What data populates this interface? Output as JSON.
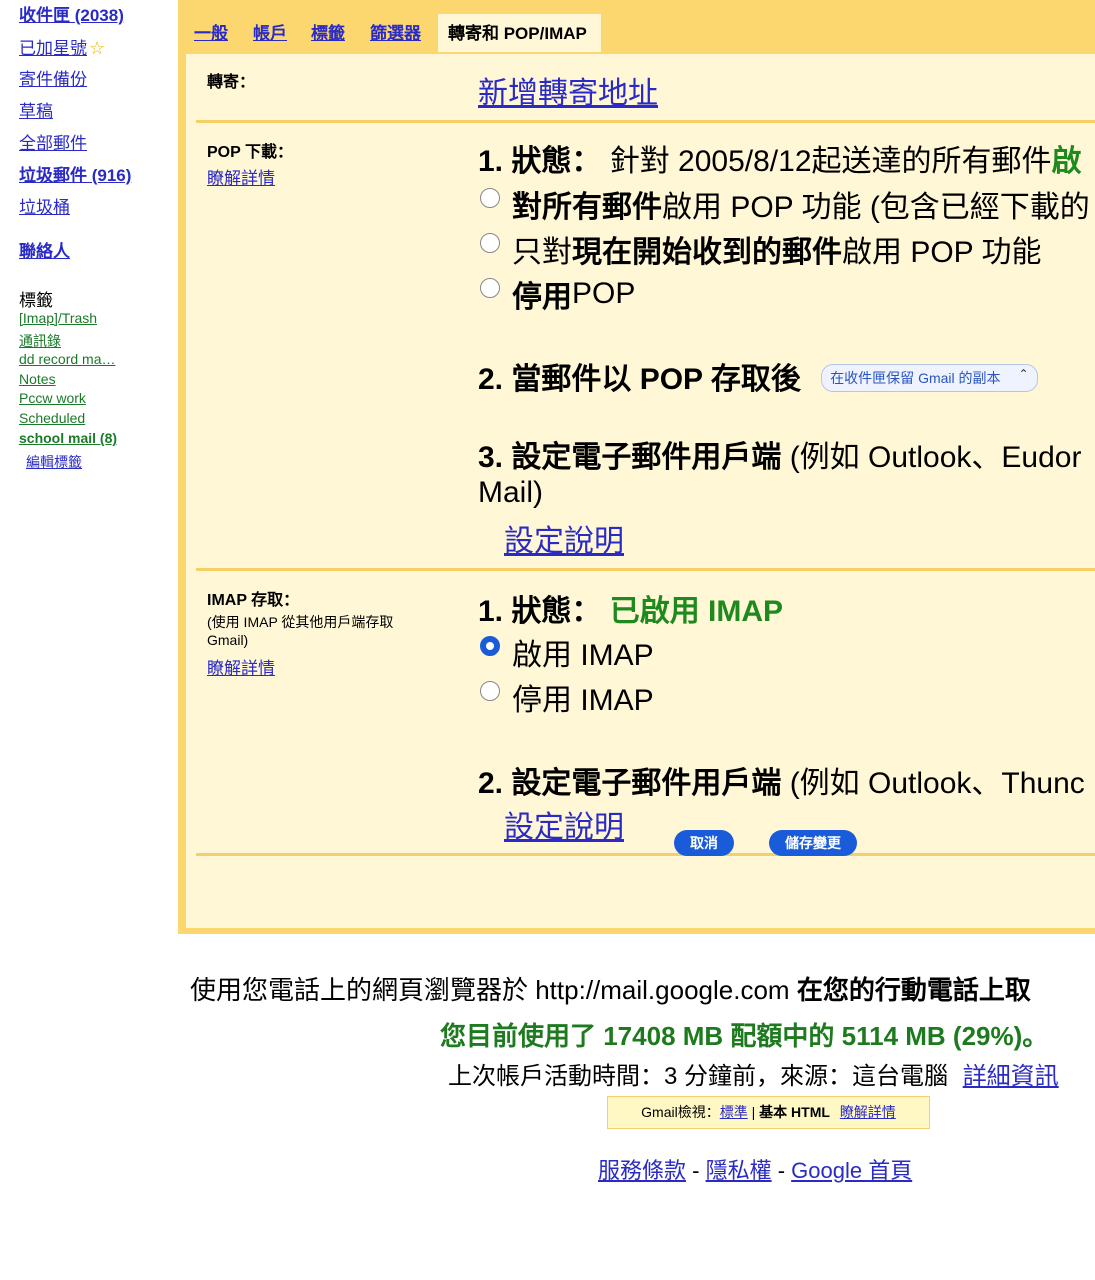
{
  "sidebar": {
    "inbox": "收件匣 (2038)",
    "starred": "已加星號",
    "sent": "寄件備份",
    "drafts": "草稿",
    "all_mail": "全部郵件",
    "spam": "垃圾郵件 (916)",
    "trash": "垃圾桶",
    "contacts": "聯絡人",
    "labels_heading": "標籤",
    "labels": [
      "[Imap]/Trash",
      "通訊錄",
      "dd record ma…",
      "Notes",
      "Pccw work",
      "Scheduled",
      "school mail (8)"
    ],
    "edit_labels": "編輯標籤"
  },
  "tabs": [
    "一般",
    "帳戶",
    "標籤",
    "篩選器",
    "轉寄和 POP/IMAP"
  ],
  "forwarding": {
    "label": "轉寄：",
    "add_link": "新增轉寄地址"
  },
  "pop": {
    "label": "POP 下載：",
    "learn_more": "瞭解詳情",
    "status_label": "1. 狀態：",
    "status_text": "針對 2005/8/12起送達的所有郵件",
    "status_suffix": "啟",
    "opt1_bold": "對所有郵件",
    "opt1_rest": "啟用 POP 功能 (包含已經下載的",
    "opt2_pre": "只對",
    "opt2_bold": "現在開始收到的郵件",
    "opt2_rest": "啟用 POP 功能",
    "opt3_bold": "停用",
    "opt3_rest": " POP",
    "after_label": "2. 當郵件以 POP 存取後",
    "after_select": "在收件匣保留 Gmail 的副本",
    "client_label": "3. 設定電子郵件用戶端",
    "client_text": " (例如 Outlook、Eudor",
    "client_text2": "Mail)",
    "setup_link": "設定說明"
  },
  "imap": {
    "label": "IMAP 存取：",
    "sub1": "(使用 IMAP 從其他用戶端存取",
    "sub2": "Gmail)",
    "learn_more": "瞭解詳情",
    "status_label": "1. 狀態：",
    "status_value": "已啟用 IMAP",
    "opt_enable": "啟用 IMAP",
    "opt_disable": "停用 IMAP",
    "client_label": "2. 設定電子郵件用戶端",
    "client_text": " (例如 Outlook、Thunc",
    "setup_link": "設定說明"
  },
  "buttons": {
    "cancel": "取消",
    "save": "儲存變更"
  },
  "footer": {
    "mobile_text": "使用您電話上的網頁瀏覽器於 http://mail.google.com ",
    "mobile_bold": "在您的行動電話上取",
    "quota": "您目前使用了 17408 MB 配額中的 5114 MB (29%)。",
    "activity": "上次帳戶活動時間：3 分鐘前，來源：這台電腦",
    "details_link": "詳細資訊",
    "view_label": "Gmail檢視：",
    "view_standard": "標準",
    "view_sep": " | ",
    "view_basic": "基本 HTML",
    "view_learn": "瞭解詳情",
    "terms": "服務條款",
    "dash1": " - ",
    "privacy": "隱私權",
    "dash2": " - ",
    "google_home": "Google 首頁"
  },
  "colors": {
    "panel": "#fcd770",
    "panel_inner": "#fff7d6",
    "link": "#2a2ac6",
    "label_green": "#1a7a2a",
    "status_green": "#1e8a1e",
    "button_blue": "#1a5bd9"
  }
}
